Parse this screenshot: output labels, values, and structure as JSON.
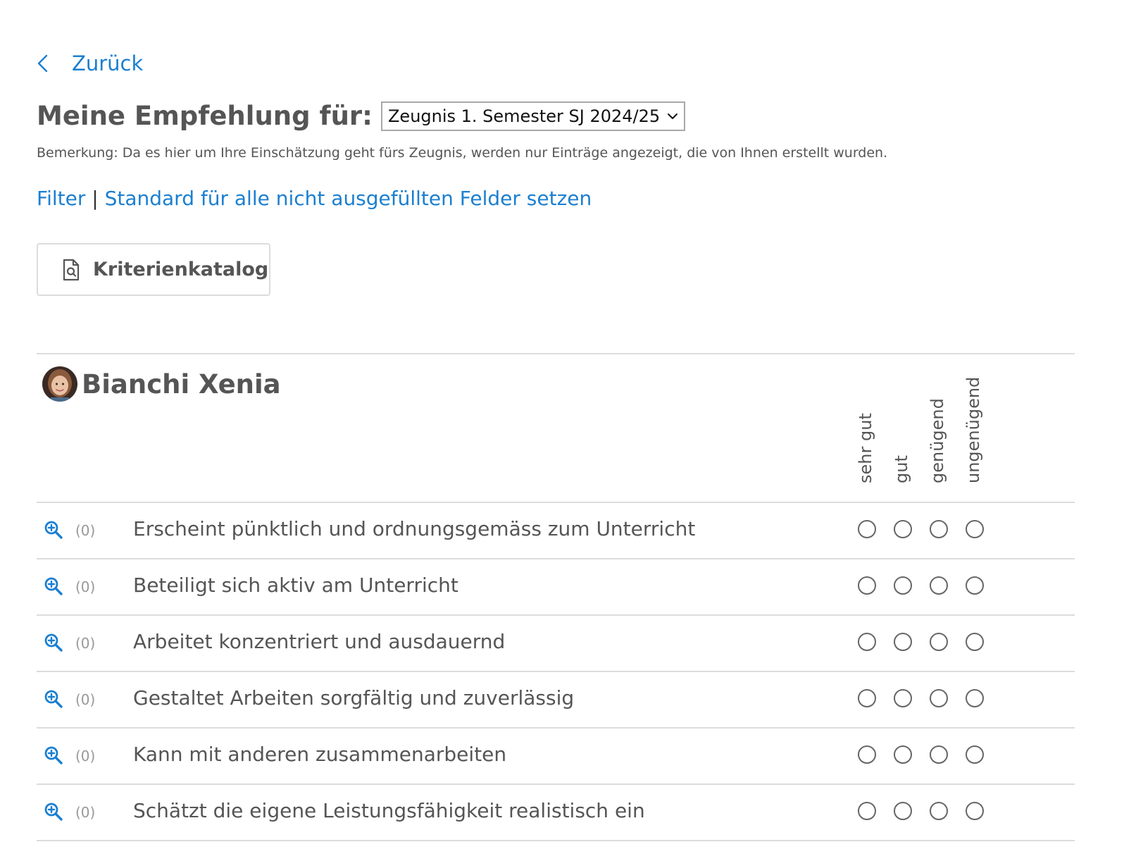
{
  "nav": {
    "back_label": "Zurück"
  },
  "header": {
    "title": "Meine Empfehlung für:",
    "report_select": {
      "selected": "Zeugnis 1. Semester SJ 2024/25"
    },
    "remark": "Bemerkung: Da es hier um Ihre Einschätzung geht fürs Zeugnis, werden nur Einträge angezeigt, die von Ihnen erstellt wurden."
  },
  "actions": {
    "filter_label": "Filter",
    "separator": "|",
    "set_default_label": "Standard für alle nicht ausgefüllten Felder setzen",
    "catalog_button_label": "Kriterienkatalog"
  },
  "student": {
    "name": "Bianchi Xenia"
  },
  "rating_columns": [
    "sehr gut",
    "gut",
    "genügend",
    "ungenügend"
  ],
  "criteria": [
    {
      "count": "(0)",
      "label": "Erscheint pünktlich und ordnungsgemäss zum Unterricht"
    },
    {
      "count": "(0)",
      "label": "Beteiligt sich aktiv am Unterricht"
    },
    {
      "count": "(0)",
      "label": "Arbeitet konzentriert und ausdauernd"
    },
    {
      "count": "(0)",
      "label": "Gestaltet Arbeiten sorgfältig und zuverlässig"
    },
    {
      "count": "(0)",
      "label": "Kann mit anderen zusammenarbeiten"
    },
    {
      "count": "(0)",
      "label": "Schätzt die eigene Leistungsfähigkeit realistisch ein"
    }
  ],
  "colors": {
    "link": "#1b7fd0",
    "text": "#555555",
    "muted": "#999999",
    "divider": "#dcdcdc"
  }
}
